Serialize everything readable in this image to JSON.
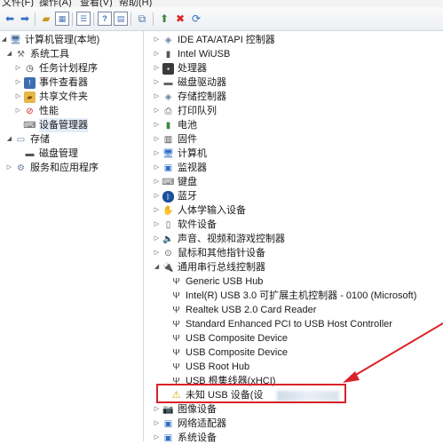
{
  "menubar": {
    "items": [
      "文件(F)",
      "操作(A)",
      "查看(V)",
      "帮助(H)"
    ]
  },
  "toolbar": {
    "buttons": [
      "back-icon",
      "forward-icon",
      "up-folder-icon",
      "show-hide-icon",
      "properties-icon",
      "help-icon",
      "scan-hardware-icon",
      "update-driver-icon",
      "uninstall-icon",
      "enable-icon"
    ]
  },
  "left_tree": [
    {
      "label": "计算机管理(本地)",
      "icon": "computer-management-icon",
      "expander": "◢"
    },
    {
      "label": "系统工具",
      "icon": "tools-icon",
      "expander": "◢"
    },
    {
      "label": "任务计划程序",
      "icon": "clock-icon",
      "expander": "▷"
    },
    {
      "label": "事件查看器",
      "icon": "event-viewer-icon",
      "expander": "▷"
    },
    {
      "label": "共享文件夹",
      "icon": "shared-folder-icon",
      "expander": "▷"
    },
    {
      "label": "性能",
      "icon": "performance-icon",
      "expander": "▷"
    },
    {
      "label": "设备管理器",
      "icon": "device-manager-icon",
      "expander": ""
    },
    {
      "label": "存储",
      "icon": "storage-icon",
      "expander": "◢"
    },
    {
      "label": "磁盘管理",
      "icon": "disk-icon",
      "expander": ""
    },
    {
      "label": "服务和应用程序",
      "icon": "services-icon",
      "expander": "▷"
    }
  ],
  "right_tree": [
    {
      "label": "IDE ATA/ATAPI 控制器",
      "icon": "ide-controller-icon",
      "expander": "▷"
    },
    {
      "label": "Intel WiUSB",
      "icon": "wiusb-icon",
      "expander": "▷"
    },
    {
      "label": "处理器",
      "icon": "processor-icon",
      "expander": "▷"
    },
    {
      "label": "磁盘驱动器",
      "icon": "disk-drive-icon",
      "expander": "▷"
    },
    {
      "label": "存储控制器",
      "icon": "storage-controller-icon",
      "expander": "▷"
    },
    {
      "label": "打印队列",
      "icon": "printer-icon",
      "expander": "▷"
    },
    {
      "label": "电池",
      "icon": "battery-icon",
      "expander": "▷"
    },
    {
      "label": "固件",
      "icon": "firmware-icon",
      "expander": "▷"
    },
    {
      "label": "计算机",
      "icon": "computer-icon",
      "expander": "▷"
    },
    {
      "label": "监视器",
      "icon": "monitor-icon",
      "expander": "▷"
    },
    {
      "label": "键盘",
      "icon": "keyboard-icon",
      "expander": "▷"
    },
    {
      "label": "蓝牙",
      "icon": "bluetooth-icon",
      "expander": "▷"
    },
    {
      "label": "人体学输入设备",
      "icon": "hid-icon",
      "expander": "▷"
    },
    {
      "label": "软件设备",
      "icon": "software-device-icon",
      "expander": "▷"
    },
    {
      "label": "声音、视频和游戏控制器",
      "icon": "sound-icon",
      "expander": "▷"
    },
    {
      "label": "鼠标和其他指针设备",
      "icon": "mouse-icon",
      "expander": "▷"
    },
    {
      "label": "通用串行总线控制器",
      "icon": "usb-icon",
      "expander": "◢"
    },
    {
      "label": "Generic USB Hub",
      "icon": "usb-plug-icon",
      "expander": ""
    },
    {
      "label": "Intel(R) USB 3.0 可扩展主机控制器 - 0100 (Microsoft)",
      "icon": "usb-plug-icon",
      "expander": ""
    },
    {
      "label": "Realtek USB 2.0 Card Reader",
      "icon": "usb-plug-icon",
      "expander": ""
    },
    {
      "label": "Standard Enhanced PCI to USB Host Controller",
      "icon": "usb-plug-icon",
      "expander": ""
    },
    {
      "label": "USB Composite Device",
      "icon": "usb-plug-icon",
      "expander": ""
    },
    {
      "label": "USB Composite Device",
      "icon": "usb-plug-icon",
      "expander": ""
    },
    {
      "label": "USB Root Hub",
      "icon": "usb-plug-icon",
      "expander": ""
    },
    {
      "label": "USB 根集线器(xHCI)",
      "icon": "usb-plug-icon",
      "expander": ""
    },
    {
      "label": "未知 USB 设备(设",
      "icon": "warning-device-icon",
      "expander": ""
    },
    {
      "label": "图像设备",
      "icon": "imaging-device-icon",
      "expander": "▷"
    },
    {
      "label": "网络适配器",
      "icon": "network-adapter-icon",
      "expander": "▷"
    },
    {
      "label": "系统设备",
      "icon": "system-device-icon",
      "expander": "▷"
    }
  ],
  "colors": {
    "highlight": "#d8232a",
    "selection": "#e4eef9",
    "toolbar": "#eceff3"
  }
}
